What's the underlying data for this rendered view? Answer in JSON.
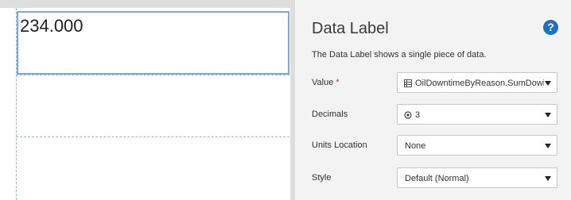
{
  "canvas": {
    "tile_value": "234.000"
  },
  "panel": {
    "title": "Data Label",
    "help_icon": "question-circle-icon",
    "description": "The Data Label shows a single piece of data.",
    "fields": {
      "value": {
        "label": "Value",
        "required_mark": "*",
        "selected": "OilDowntimeByReason.SumDowi",
        "icon": "table-icon"
      },
      "decimals": {
        "label": "Decimals",
        "selected": "3",
        "icon": "target-icon"
      },
      "units_location": {
        "label": "Units Location",
        "selected": "None"
      },
      "style": {
        "label": "Style",
        "selected": "Default (Normal)"
      }
    }
  },
  "colors": {
    "accent": "#1e6fc6",
    "selection_border": "#7fa7dc",
    "required": "#d6342f",
    "panel_bg": "#f3f3f3"
  }
}
